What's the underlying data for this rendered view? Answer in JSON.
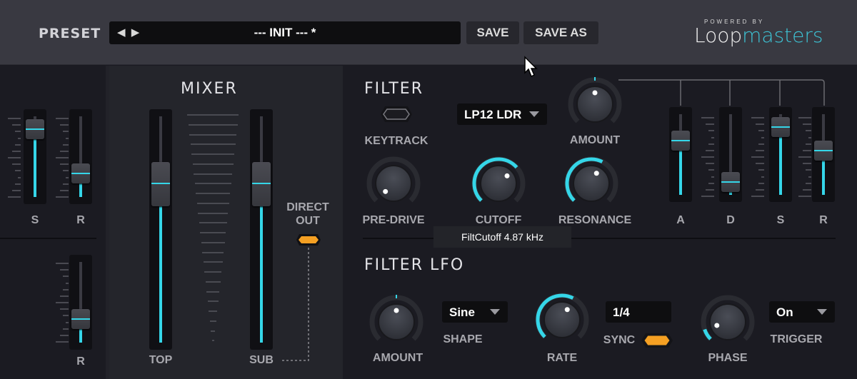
{
  "header": {
    "preset_label": "PRESET",
    "preset_arrows": "◀ ▶",
    "preset_name": "--- INIT --- *",
    "save_label": "SAVE",
    "save_as_label": "SAVE AS",
    "logo": {
      "powered_by": "POWERED BY",
      "brand_part1": "Loop",
      "brand_part2": "masters"
    }
  },
  "left_env": {
    "top_sliders": [
      {
        "label": "S",
        "value": 0.95
      },
      {
        "label": "R",
        "value": 0.22
      }
    ],
    "bottom_sliders": [
      {
        "label": "R",
        "value": 0.22
      }
    ]
  },
  "mixer": {
    "title": "MIXER",
    "sliders": [
      {
        "label": "TOP",
        "value": 0.75
      },
      {
        "label": "SUB",
        "value": 0.75
      }
    ],
    "direct_out": {
      "label_line1": "DIRECT",
      "label_line2": "OUT",
      "on": true
    }
  },
  "filter": {
    "title": "FILTER",
    "keytrack": {
      "label": "KEYTRACK",
      "on": false
    },
    "type_dropdown": {
      "value": "LP12 LDR"
    },
    "amount": {
      "label": "AMOUNT",
      "value": 0.5,
      "bipolar": true
    },
    "pre_drive": {
      "label": "PRE-DRIVE",
      "value": 0.0
    },
    "cutoff": {
      "label": "CUTOFF",
      "value": 0.68
    },
    "resonance": {
      "label": "RESONANCE",
      "value": 0.6
    },
    "envelope": [
      {
        "label": "A",
        "value": 0.73
      },
      {
        "label": "D",
        "value": 0.05
      },
      {
        "label": "S",
        "value": 0.95
      },
      {
        "label": "R",
        "value": 0.57
      }
    ],
    "tooltip": "FiltCutoff 4.87 kHz"
  },
  "filter_lfo": {
    "title": "FILTER LFO",
    "amount": {
      "label": "AMOUNT",
      "value": 0.5,
      "bipolar": true
    },
    "shape": {
      "label": "SHAPE",
      "value": "Sine"
    },
    "rate": {
      "label": "RATE",
      "value": 0.6
    },
    "sync": {
      "label": "SYNC",
      "value": "1/4",
      "on": true
    },
    "phase": {
      "label": "PHASE",
      "value": 0.1
    },
    "trigger": {
      "label": "TRIGGER",
      "value": "On"
    }
  },
  "colors": {
    "accent": "#35d6e8",
    "toggle_on": "#f5a023",
    "bg": "#1b1b22",
    "header": "#393941"
  }
}
